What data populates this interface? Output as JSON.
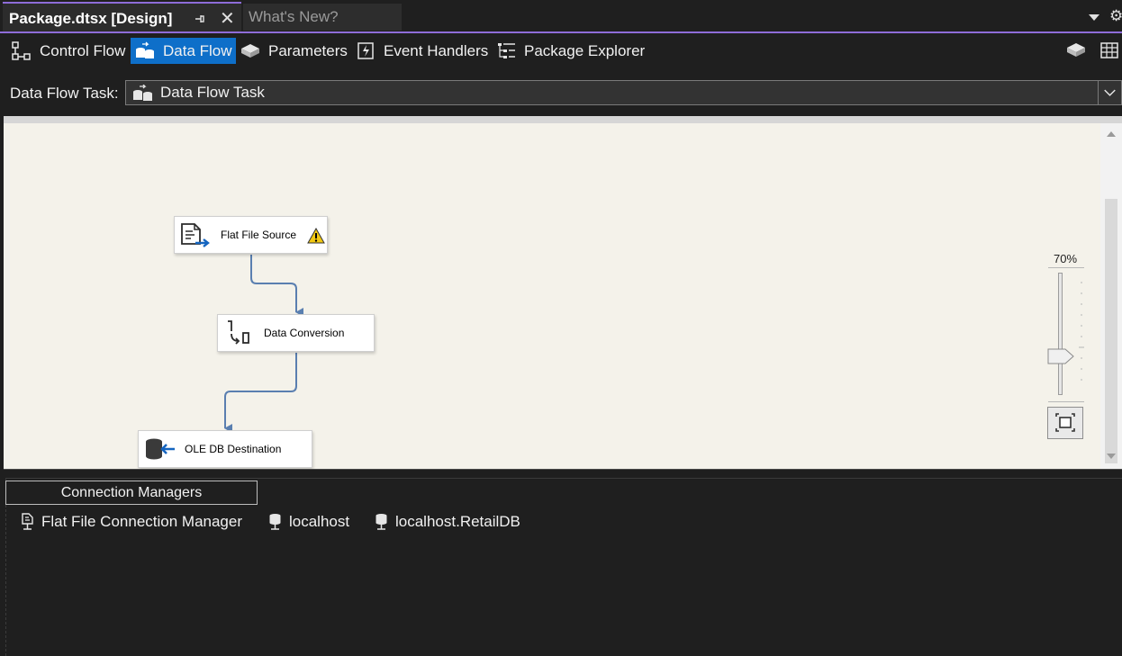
{
  "tabs": {
    "active": {
      "title": "Package.dtsx [Design]"
    },
    "inactive": {
      "title": "What's New?"
    }
  },
  "designer_tabs": [
    {
      "label": "Control Flow",
      "icon": "control-flow-icon"
    },
    {
      "label": "Data Flow",
      "icon": "data-flow-icon",
      "selected": true
    },
    {
      "label": "Parameters",
      "icon": "parameters-icon"
    },
    {
      "label": "Event Handlers",
      "icon": "event-handlers-icon"
    },
    {
      "label": "Package Explorer",
      "icon": "package-explorer-icon"
    }
  ],
  "task_selector": {
    "label": "Data Flow Task:",
    "value": "Data Flow Task"
  },
  "components": [
    {
      "name": "Flat File Source",
      "icon": "flat-file-source-icon",
      "status": "warning"
    },
    {
      "name": "Data Conversion",
      "icon": "data-conversion-icon"
    },
    {
      "name": "OLE DB Destination",
      "icon": "ole-db-destination-icon"
    }
  ],
  "zoom": {
    "level": "70%"
  },
  "connection_managers": {
    "title": "Connection Managers",
    "items": [
      {
        "name": "Flat File Connection Manager",
        "icon": "flat-file-connection-icon"
      },
      {
        "name": "localhost",
        "icon": "database-connection-icon"
      },
      {
        "name": "localhost.RetailDB",
        "icon": "database-connection-icon"
      }
    ]
  },
  "colors": {
    "accent": "#8e6cd8",
    "selected_tab": "#0e6fc9",
    "canvas": "#f4f2ea",
    "connector": "#5a7fb0",
    "warning": "#f2c811"
  }
}
